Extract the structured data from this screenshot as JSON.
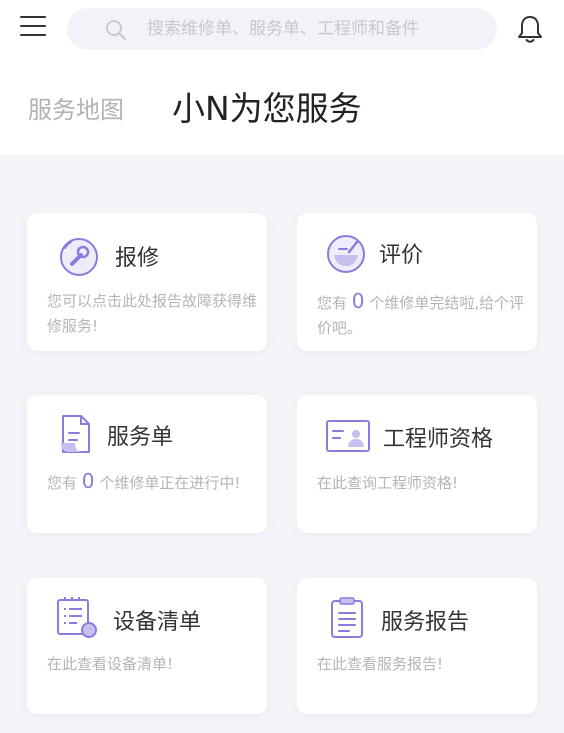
{
  "search": {
    "placeholder": "搜索维修单、服务单、工程师和备件"
  },
  "tabs": [
    {
      "label": "服务地图"
    },
    {
      "label": "小N为您服务"
    }
  ],
  "cards": {
    "repair": {
      "title": "报修",
      "desc": "您可以点击此处报告故障获得维修服务!"
    },
    "review": {
      "title": "评价",
      "desc_prefix": "您有",
      "count": "0",
      "desc_suffix": "个维修单完结啦,给个评价吧。"
    },
    "service": {
      "title": "服务单",
      "desc_prefix": "您有",
      "count": "0",
      "desc_suffix": "个维修单正在进行中!"
    },
    "engineer": {
      "title": "工程师资格",
      "desc": "在此查询工程师资格!"
    },
    "equipment": {
      "title": "设备清单",
      "desc": "在此查看设备清单!"
    },
    "report": {
      "title": "服务报告",
      "desc": "在此查看服务报告!"
    }
  },
  "colors": {
    "accent": "#8a7cdc",
    "accent_light": "#dcd7f6",
    "background": "#f5f5f9"
  }
}
